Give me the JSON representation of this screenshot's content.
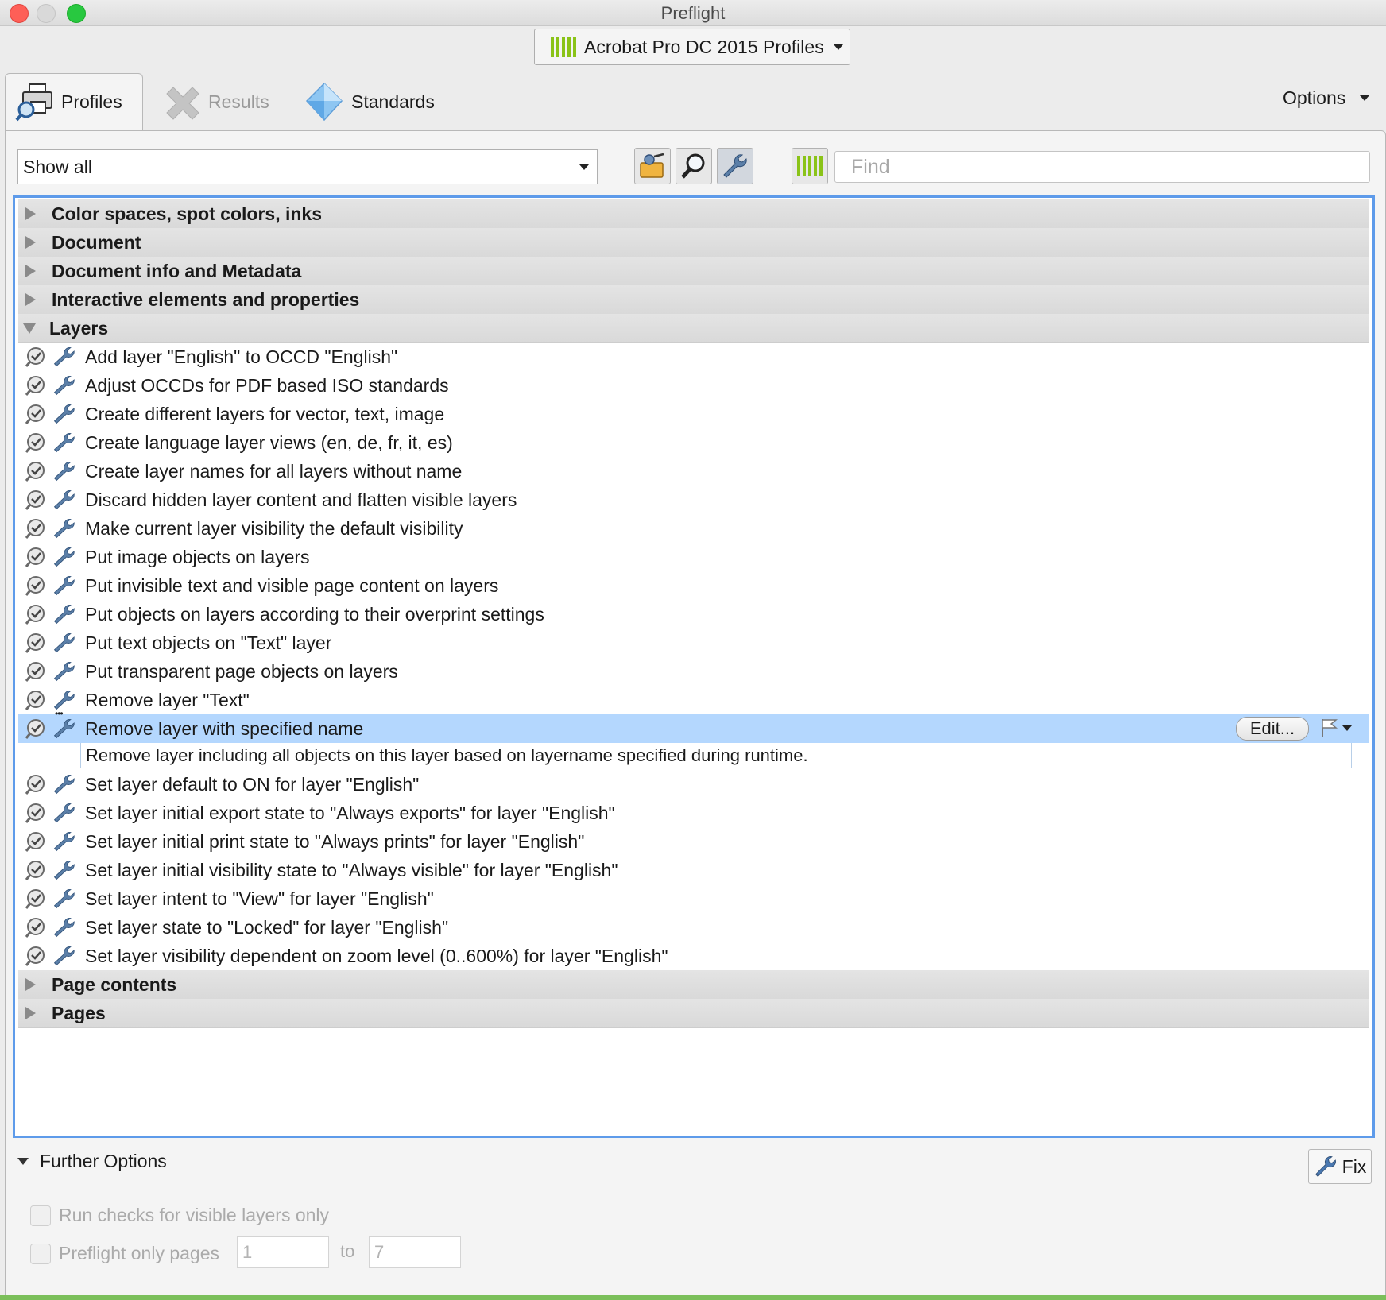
{
  "window": {
    "title": "Preflight"
  },
  "profiles_dropdown": {
    "label": "Acrobat Pro DC 2015 Profiles"
  },
  "tabs": [
    {
      "label": "Profiles",
      "icon": "printer-magnifier-icon",
      "active": true
    },
    {
      "label": "Results",
      "icon": "results-cross-icon",
      "active": false
    },
    {
      "label": "Standards",
      "icon": "diamond-icon",
      "active": false
    }
  ],
  "options_label": "Options",
  "filter": {
    "selected": "Show all"
  },
  "search": {
    "placeholder": "Find"
  },
  "categories_top": [
    "Color spaces, spot colors, inks",
    "Document",
    "Document info and Metadata",
    "Interactive elements and properties"
  ],
  "layers_category": "Layers",
  "layer_items": [
    "Add layer \"English\" to OCCD \"English\"",
    "Adjust OCCDs for PDF based ISO standards",
    "Create different layers for vector, text, image",
    "Create language layer views (en, de, fr, it, es)",
    "Create layer names for all layers without name",
    "Discard hidden layer content and flatten visible layers",
    "Make current layer visibility the default visibility",
    "Put image objects on layers",
    "Put invisible text and visible page content on layers",
    "Put objects on layers according to their overprint settings",
    "Put text objects on \"Text\" layer",
    "Put transparent page objects on layers",
    "Remove layer \"Text\""
  ],
  "selected_item": {
    "label": "Remove layer with specified name",
    "description": "Remove layer including all objects on this layer based on layername specified during runtime.",
    "edit_label": "Edit..."
  },
  "layer_items_after": [
    "Set layer default to ON for layer \"English\"",
    "Set layer initial export state to \"Always exports\" for layer \"English\"",
    "Set layer initial print state to \"Always prints\" for layer \"English\"",
    "Set layer initial visibility state to \"Always visible\" for layer \"English\"",
    "Set layer intent to \"View\" for layer \"English\"",
    "Set layer state to \"Locked\" for layer \"English\"",
    "Set layer visibility dependent on zoom level (0..600%) for layer \"English\""
  ],
  "categories_bottom": [
    "Page contents",
    "Pages"
  ],
  "further_options": {
    "label": "Further Options",
    "visible_layers_only": "Run checks for visible layers only",
    "preflight_only_pages": "Preflight only pages",
    "from_page": "1",
    "to_label": "to",
    "to_page": "7"
  },
  "fix_label": "Fix",
  "colors": {
    "accent": "#5e9bea",
    "selection": "#b4d7fe",
    "brand_green": "#8ac318"
  }
}
